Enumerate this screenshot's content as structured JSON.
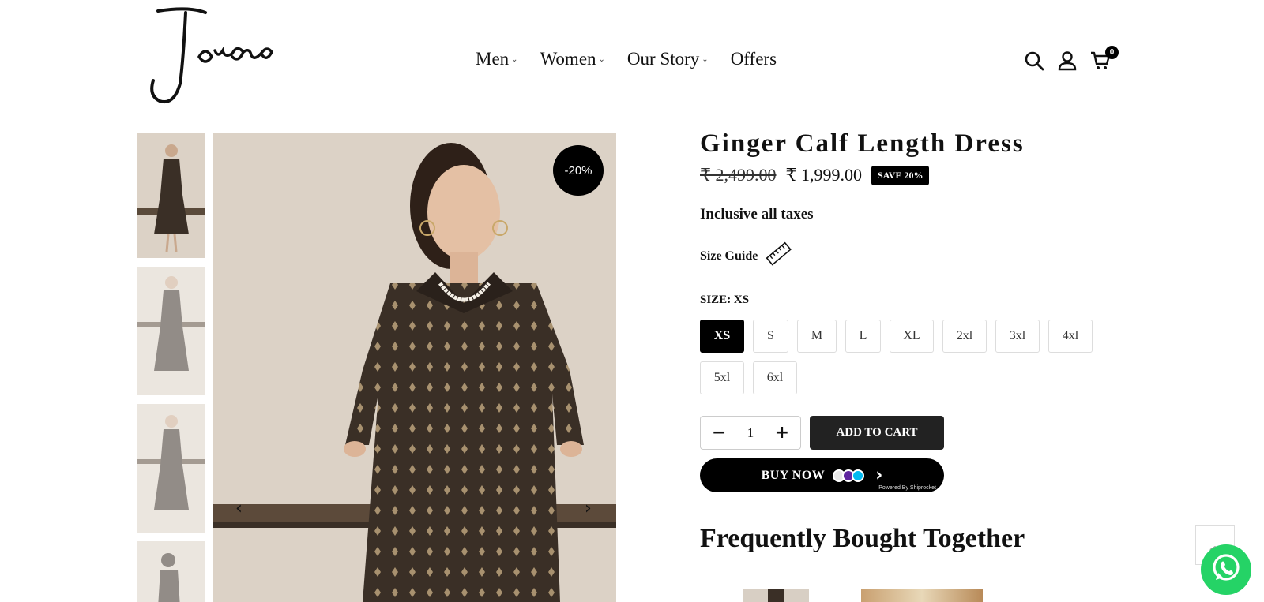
{
  "header": {
    "logo_text": "Jorasa",
    "nav": [
      {
        "label": "Men",
        "has_dropdown": true
      },
      {
        "label": "Women",
        "has_dropdown": true
      },
      {
        "label": "Our Story",
        "has_dropdown": true
      },
      {
        "label": "Offers",
        "has_dropdown": false
      }
    ],
    "icons": [
      "search-icon",
      "account-icon",
      "cart-icon"
    ],
    "cart_count": "0"
  },
  "gallery": {
    "discount_badge": "-20%",
    "prev_arrow": "‹",
    "next_arrow": "›",
    "thumbnail_count": 4
  },
  "product": {
    "title": "Ginger Calf Length Dress",
    "original_price": "₹ 2,499.00",
    "sale_price": "₹ 1,999.00",
    "save_badge": "SAVE 20%",
    "taxes_note": "Inclusive all taxes",
    "size_guide_label": "Size Guide",
    "size_label": "SIZE: XS",
    "sizes": [
      "XS",
      "S",
      "M",
      "L",
      "XL",
      "2xl",
      "3xl",
      "4xl",
      "5xl",
      "6xl"
    ],
    "selected_size": "XS",
    "quantity": "1",
    "add_to_cart_label": "ADD TO CART",
    "buy_now_label": "BUY NOW",
    "powered_by": "Powered By Shiprocket"
  },
  "frequently_bought": {
    "heading": "Frequently Bought Together"
  },
  "colors": {
    "accent": "#000000",
    "whatsapp": "#25d366",
    "dress": "#3a2f26",
    "background_wall": "#dcd2c6"
  }
}
